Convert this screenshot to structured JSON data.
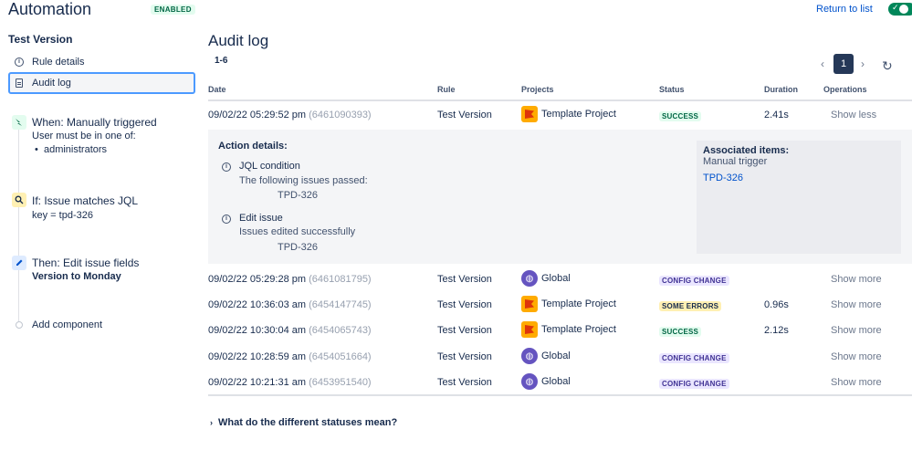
{
  "header": {
    "app_title": "Automation",
    "status_badge": "ENABLED",
    "return_link": "Return to list",
    "toggle_state": "on"
  },
  "sidebar": {
    "rule_name": "Test Version",
    "items": [
      {
        "label": "Rule details",
        "icon": "info-icon"
      },
      {
        "label": "Audit log",
        "icon": "document-icon",
        "active": true
      }
    ],
    "components": [
      {
        "type": "trigger",
        "title": "When: Manually triggered",
        "lines": [
          "User must be in one of:"
        ],
        "bullets": [
          "administrators"
        ],
        "icon": "trigger-icon"
      },
      {
        "type": "condition",
        "title": "If: Issue matches JQL",
        "lines": [
          "key = tpd-326"
        ],
        "icon": "search-icon"
      },
      {
        "type": "action",
        "title": "Then: Edit issue fields",
        "bold_line": "Version to Monday",
        "icon": "pencil-icon"
      }
    ],
    "add_component": "Add component"
  },
  "main": {
    "title": "Audit log",
    "range": "1-6",
    "pagination": {
      "current_page": "1"
    },
    "columns": [
      "Date",
      "Rule",
      "Projects",
      "Status",
      "Duration",
      "Operations"
    ],
    "rows": [
      {
        "date": "09/02/22 05:29:52 pm",
        "id": "(6461090393)",
        "rule": "Test Version",
        "project": "Template Project",
        "project_icon": "flag",
        "status": "SUCCESS",
        "status_kind": "success",
        "duration": "2.41s",
        "op": "Show less"
      },
      {
        "date": "09/02/22 05:29:28 pm",
        "id": "(6461081795)",
        "rule": "Test Version",
        "project": "Global",
        "project_icon": "globe",
        "status": "CONFIG CHANGE",
        "status_kind": "config",
        "duration": "",
        "op": "Show more"
      },
      {
        "date": "09/02/22 10:36:03 am",
        "id": "(6454147745)",
        "rule": "Test Version",
        "project": "Template Project",
        "project_icon": "flag",
        "status": "SOME ERRORS",
        "status_kind": "errors",
        "duration": "0.96s",
        "op": "Show more"
      },
      {
        "date": "09/02/22 10:30:04 am",
        "id": "(6454065743)",
        "rule": "Test Version",
        "project": "Template Project",
        "project_icon": "flag",
        "status": "SUCCESS",
        "status_kind": "success",
        "duration": "2.12s",
        "op": "Show more"
      },
      {
        "date": "09/02/22 10:28:59 am",
        "id": "(6454051664)",
        "rule": "Test Version",
        "project": "Global",
        "project_icon": "globe",
        "status": "CONFIG CHANGE",
        "status_kind": "config",
        "duration": "",
        "op": "Show more"
      },
      {
        "date": "09/02/22 10:21:31 am",
        "id": "(6453951540)",
        "rule": "Test Version",
        "project": "Global",
        "project_icon": "globe",
        "status": "CONFIG CHANGE",
        "status_kind": "config",
        "duration": "",
        "op": "Show more"
      }
    ],
    "details": {
      "heading": "Action details:",
      "actions": [
        {
          "title": "JQL condition",
          "sub": "The following issues passed:",
          "value": "TPD-326"
        },
        {
          "title": "Edit issue",
          "sub": "Issues edited successfully",
          "value": "TPD-326"
        }
      ],
      "associated": {
        "heading": "Associated items:",
        "text": "Manual trigger",
        "link": "TPD-326"
      }
    },
    "faq": "What do the different statuses mean?"
  },
  "colors": {
    "accent": "#0052cc",
    "success": "#006644",
    "config": "#403294",
    "errors": "#fff0b3",
    "toggle_on": "#00875a"
  }
}
